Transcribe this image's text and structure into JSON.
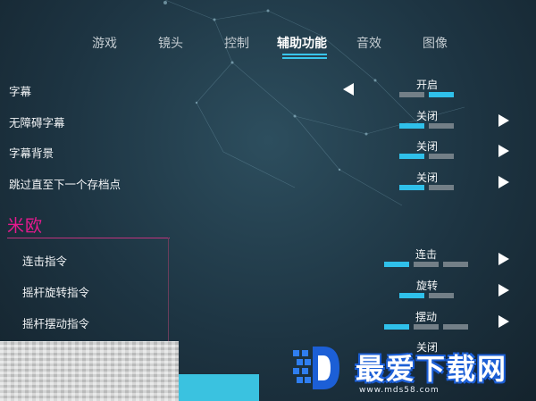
{
  "tabs": [
    {
      "label": "游戏",
      "active": false
    },
    {
      "label": "镜头",
      "active": false
    },
    {
      "label": "控制",
      "active": false
    },
    {
      "label": "辅助功能",
      "active": true
    },
    {
      "label": "音效",
      "active": false
    },
    {
      "label": "图像",
      "active": false
    }
  ],
  "settings": [
    {
      "label": "字幕",
      "value": "开启",
      "selected_index": 1,
      "segments": 2
    },
    {
      "label": "无障碍字幕",
      "value": "关闭",
      "selected_index": 0,
      "segments": 2
    },
    {
      "label": "字幕背景",
      "value": "关闭",
      "selected_index": 0,
      "segments": 2
    },
    {
      "label": "跳过直至下一个存档点",
      "value": "关闭",
      "selected_index": 0,
      "segments": 2
    }
  ],
  "section": {
    "title": "米欧",
    "settings": [
      {
        "label": "连击指令",
        "value": "连击",
        "selected_index": 0,
        "segments": 3
      },
      {
        "label": "摇杆旋转指令",
        "value": "旋转",
        "selected_index": 0,
        "segments": 2
      },
      {
        "label": "摇杆摆动指令",
        "value": "摆动",
        "selected_index": 0,
        "segments": 3
      },
      {
        "label": "",
        "value": "关闭",
        "selected_index": 0,
        "segments": 2
      }
    ]
  },
  "watermark": {
    "title": "最爱下载网",
    "url": "www.mds58.com",
    "color": "#1c5fd6"
  },
  "colors": {
    "accent": "#2fc0ea",
    "section": "#e7198f",
    "inactive_segment": "#737f87"
  }
}
